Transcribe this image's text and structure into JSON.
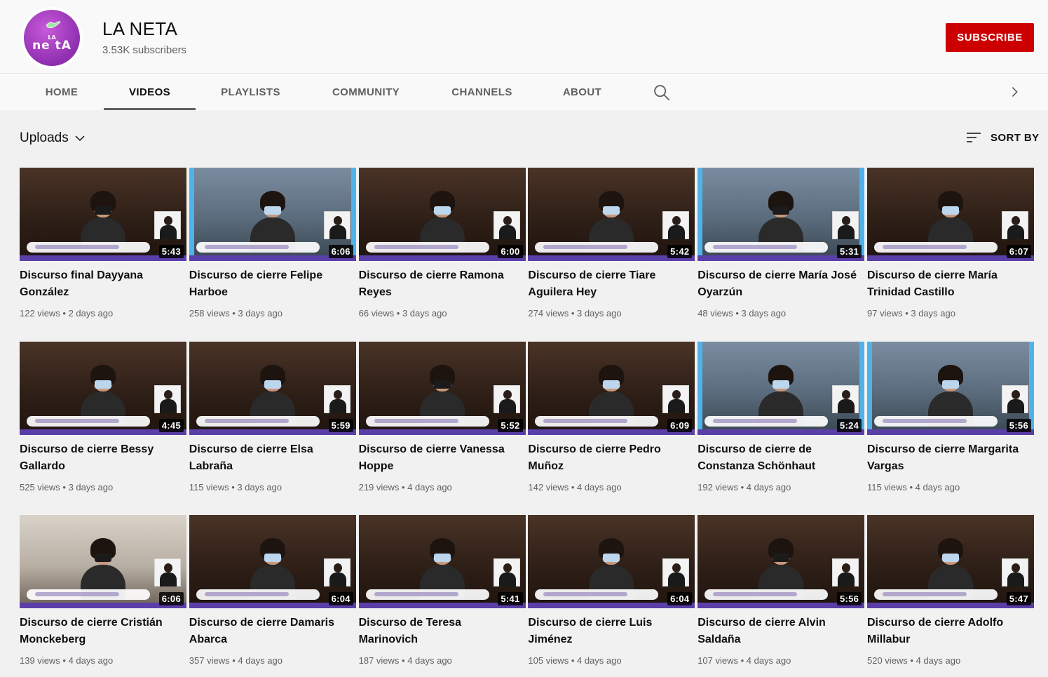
{
  "channel": {
    "name": "LA NETA",
    "subscribers": "3.53K subscribers",
    "avatar_text_small": "LA",
    "avatar_text_big": "ne tA",
    "subscribe_label": "SUBSCRIBE",
    "brand_color": "#cc0000",
    "avatar_color": "#9b3bc2"
  },
  "tabs": [
    {
      "label": "HOME"
    },
    {
      "label": "VIDEOS"
    },
    {
      "label": "PLAYLISTS"
    },
    {
      "label": "COMMUNITY"
    },
    {
      "label": "CHANNELS"
    },
    {
      "label": "ABOUT"
    }
  ],
  "active_tab": "VIDEOS",
  "icons": {
    "search": "search-icon",
    "next": "chevron-right-icon",
    "sort": "sort-icon",
    "dropdown": "chevron-down-icon"
  },
  "section": {
    "uploads_label": "Uploads",
    "sort_label": "SORT BY"
  },
  "videos": [
    {
      "title": "Discurso final Dayyana González",
      "views": "122 views",
      "age": "2 days ago",
      "duration": "5:43",
      "style": "dark"
    },
    {
      "title": "Discurso de cierre Felipe Harboe",
      "views": "258 views",
      "age": "3 days ago",
      "duration": "6:06",
      "style": "blue"
    },
    {
      "title": "Discurso de cierre Ramona Reyes",
      "views": "66 views",
      "age": "3 days ago",
      "duration": "6:00",
      "style": "dark"
    },
    {
      "title": "Discurso de cierre Tiare Aguilera Hey",
      "views": "274 views",
      "age": "3 days ago",
      "duration": "5:42",
      "style": "dark"
    },
    {
      "title": "Discurso de cierre María José Oyarzún",
      "views": "48 views",
      "age": "3 days ago",
      "duration": "5:31",
      "style": "blue"
    },
    {
      "title": "Discurso de cierre María Trinidad Castillo",
      "views": "97 views",
      "age": "3 days ago",
      "duration": "6:07",
      "style": "dark"
    },
    {
      "title": "Discurso de cierre Bessy Gallardo",
      "views": "525 views",
      "age": "3 days ago",
      "duration": "4:45",
      "style": "dark"
    },
    {
      "title": "Discurso de cierre Elsa Labraña",
      "views": "115 views",
      "age": "3 days ago",
      "duration": "5:59",
      "style": "dark"
    },
    {
      "title": "Discurso de cierre Vanessa Hoppe",
      "views": "219 views",
      "age": "4 days ago",
      "duration": "5:52",
      "style": "dark"
    },
    {
      "title": "Discurso de cierre Pedro Muñoz",
      "views": "142 views",
      "age": "4 days ago",
      "duration": "6:09",
      "style": "dark"
    },
    {
      "title": "Discurso de cierre de Constanza Schönhaut",
      "views": "192 views",
      "age": "4 days ago",
      "duration": "5:24",
      "style": "blue"
    },
    {
      "title": "Discurso de cierre Margarita Vargas",
      "views": "115 views",
      "age": "4 days ago",
      "duration": "5:56",
      "style": "blue"
    },
    {
      "title": "Discurso de cierre Cristián Monckeberg",
      "views": "139 views",
      "age": "4 days ago",
      "duration": "6:06",
      "style": "light"
    },
    {
      "title": "Discurso de cierre Damaris Abarca",
      "views": "357 views",
      "age": "4 days ago",
      "duration": "6:04",
      "style": "dark"
    },
    {
      "title": "Discurso de Teresa Marinovich",
      "views": "187 views",
      "age": "4 days ago",
      "duration": "5:41",
      "style": "dark"
    },
    {
      "title": "Discurso de cierre Luis Jiménez",
      "views": "105 views",
      "age": "4 days ago",
      "duration": "6:04",
      "style": "dark"
    },
    {
      "title": "Discurso de cierre Alvin Saldaña",
      "views": "107 views",
      "age": "4 days ago",
      "duration": "5:56",
      "style": "dark"
    },
    {
      "title": "Discurso de cierre Adolfo Millabur",
      "views": "520 views",
      "age": "4 days ago",
      "duration": "5:47",
      "style": "dark"
    }
  ]
}
